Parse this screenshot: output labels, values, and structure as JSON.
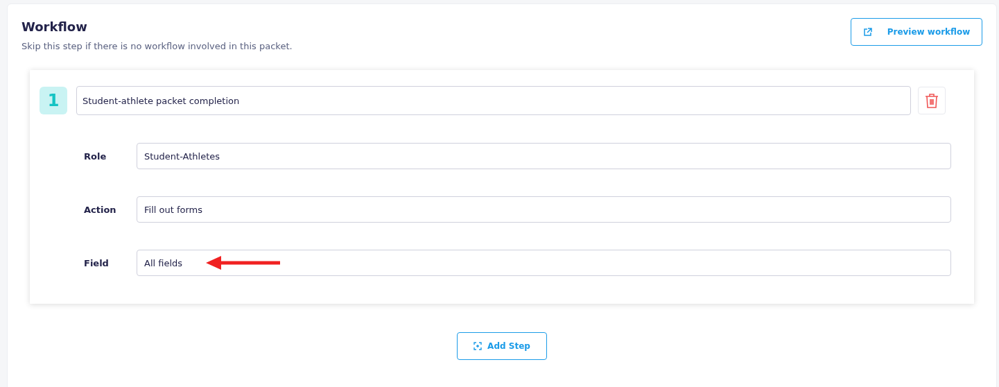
{
  "header": {
    "title": "Workflow",
    "subtitle": "Skip this step if there is no workflow involved in this packet.",
    "preview_button": "Preview workflow"
  },
  "steps": [
    {
      "number": "1",
      "name": "Student-athlete packet completion",
      "fields": [
        {
          "label": "Role",
          "value": "Student-Athletes",
          "annotated": false
        },
        {
          "label": "Action",
          "value": "Fill out forms",
          "annotated": false
        },
        {
          "label": "Field",
          "value": "All fields",
          "annotated": true
        }
      ]
    }
  ],
  "add_step_button": "Add Step"
}
